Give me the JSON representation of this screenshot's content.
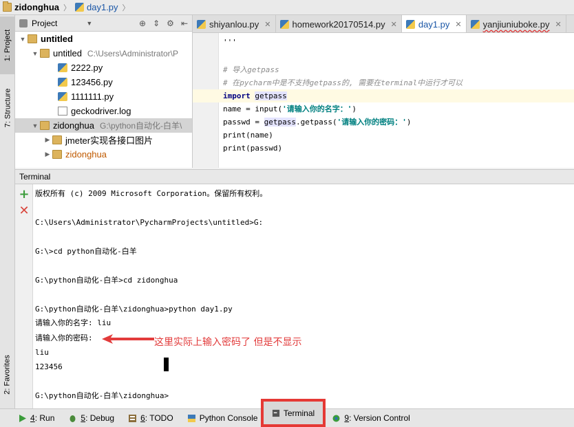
{
  "breadcrumb": {
    "project": "zidonghua",
    "file": "day1.py"
  },
  "left_strip": {
    "project_tab": "1: Project",
    "structure_tab": "7: Structure",
    "favorites_tab": "2: Favorites"
  },
  "project_panel": {
    "title": "Project",
    "tree": [
      {
        "label": "untitled"
      },
      {
        "label": "untitled",
        "path": "C:\\Users\\Administrator\\P"
      },
      {
        "label": "2222.py"
      },
      {
        "label": "123456.py"
      },
      {
        "label": "1111111.py"
      },
      {
        "label": "geckodriver.log"
      },
      {
        "label": "zidonghua",
        "path": "G:\\python自动化-白羊\\"
      },
      {
        "label": "jmeter实现各接口图片"
      },
      {
        "label": "zidonghua"
      }
    ]
  },
  "editor_tabs": [
    {
      "label": "shiyanlou.py"
    },
    {
      "label": "homework20170514.py"
    },
    {
      "label": "day1.py"
    },
    {
      "label": "yanjiuniuboke.py"
    }
  ],
  "code": {
    "line0": "'''",
    "line1": "# 导入getpass",
    "line2": "# 在pycharm中是不支持getpass的, 需要在terminal中运行才可以",
    "line3_kw": "import",
    "line3_mod": "getpass",
    "line4_pre": "name = input(",
    "line4_str": "'请输入你的名字：'",
    "line4_post": ")",
    "line5_pre": "passwd = ",
    "line5_mod": "getpass",
    "line5_mid": ".getpass(",
    "line5_str": "'请输入你的密码：'",
    "line5_post": ")",
    "line6": "print(name)",
    "line7": "print(passwd)"
  },
  "terminal": {
    "title": "Terminal",
    "lines": [
      "版权所有 (c) 2009 Microsoft Corporation。保留所有权利。",
      "C:\\Users\\Administrator\\PycharmProjects\\untitled>G:",
      "G:\\>cd python自动化-白羊",
      "G:\\python自动化-白羊>cd zidonghua",
      "G:\\python自动化-白羊\\zidonghua>python day1.py",
      "请输入你的名字: liu",
      "请输入你的密码:",
      "liu",
      "123456",
      "G:\\python自动化-白羊\\zidonghua>"
    ],
    "annotation": "这里实际上输入密码了 但是不显示"
  },
  "bottom_bar": {
    "run": {
      "key": "4",
      "label": ": Run"
    },
    "debug": {
      "key": "5",
      "label": ": Debug"
    },
    "todo": {
      "key": "6",
      "label": ": TODO"
    },
    "python_console": "Python Console",
    "terminal": "Terminal",
    "vcs": {
      "key": "9",
      "label": ": Version Control"
    }
  },
  "colors": {
    "annotation": "#e23b3b",
    "highlight_box": "#e53935",
    "accent_blue": "#1a56a6"
  }
}
